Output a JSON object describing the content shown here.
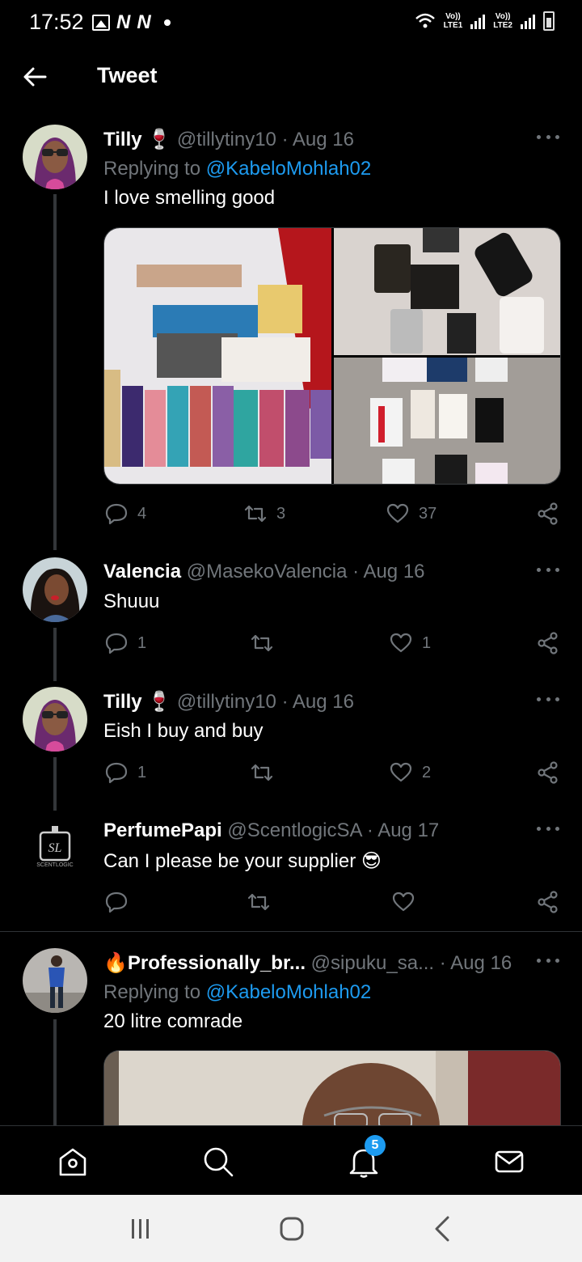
{
  "status_bar": {
    "time": "17:52",
    "n1": "N",
    "n2": "N",
    "lte1_top": "Vo))",
    "lte1_bottom": "LTE1",
    "lte2_top": "Vo))",
    "lte2_bottom": "LTE2"
  },
  "header": {
    "title": "Tweet"
  },
  "tweets": [
    {
      "name": "Tilly",
      "emoji": "🍷",
      "handle": "@tillytiny10",
      "date": "· Aug 16",
      "replying_prefix": "Replying to ",
      "replying_to": "@KabeloMohlah02",
      "text": "I love smelling good",
      "replies": "4",
      "retweets": "3",
      "likes": "37"
    },
    {
      "name": "Valencia",
      "handle": "@MasekoValencia",
      "date": "· Aug 16",
      "text": "Shuuu",
      "replies": "1",
      "retweets": "",
      "likes": "1"
    },
    {
      "name": "Tilly",
      "emoji": "🍷",
      "handle": "@tillytiny10",
      "date": "· Aug 16",
      "text": "Eish I buy and buy",
      "replies": "1",
      "retweets": "",
      "likes": "2"
    },
    {
      "name": "PerfumePapi",
      "handle": "@ScentlogicSA",
      "date": "· Aug 17",
      "text": "Can I please be your supplier 😎",
      "replies": "",
      "retweets": "",
      "likes": "",
      "logo_text": "SCENTLOGIC"
    },
    {
      "name_emoji": "🔥",
      "name": "Professionally_br...",
      "handle": "@sipuku_sa...",
      "date": "· Aug 16",
      "replying_prefix": "Replying to ",
      "replying_to": "@KabeloMohlah02",
      "text": "20 litre comrade"
    }
  ],
  "nav": {
    "notifications_badge": "5"
  },
  "icons": [
    "back-arrow-icon",
    "more-icon",
    "reply-icon",
    "retweet-icon",
    "like-icon",
    "share-icon",
    "home-icon",
    "search-icon",
    "notifications-icon",
    "messages-icon",
    "recents-icon",
    "home-circle-icon",
    "system-back-icon"
  ],
  "colors": {
    "background": "#000000",
    "accent": "#1d9bf0",
    "secondary_text": "#71767b"
  }
}
